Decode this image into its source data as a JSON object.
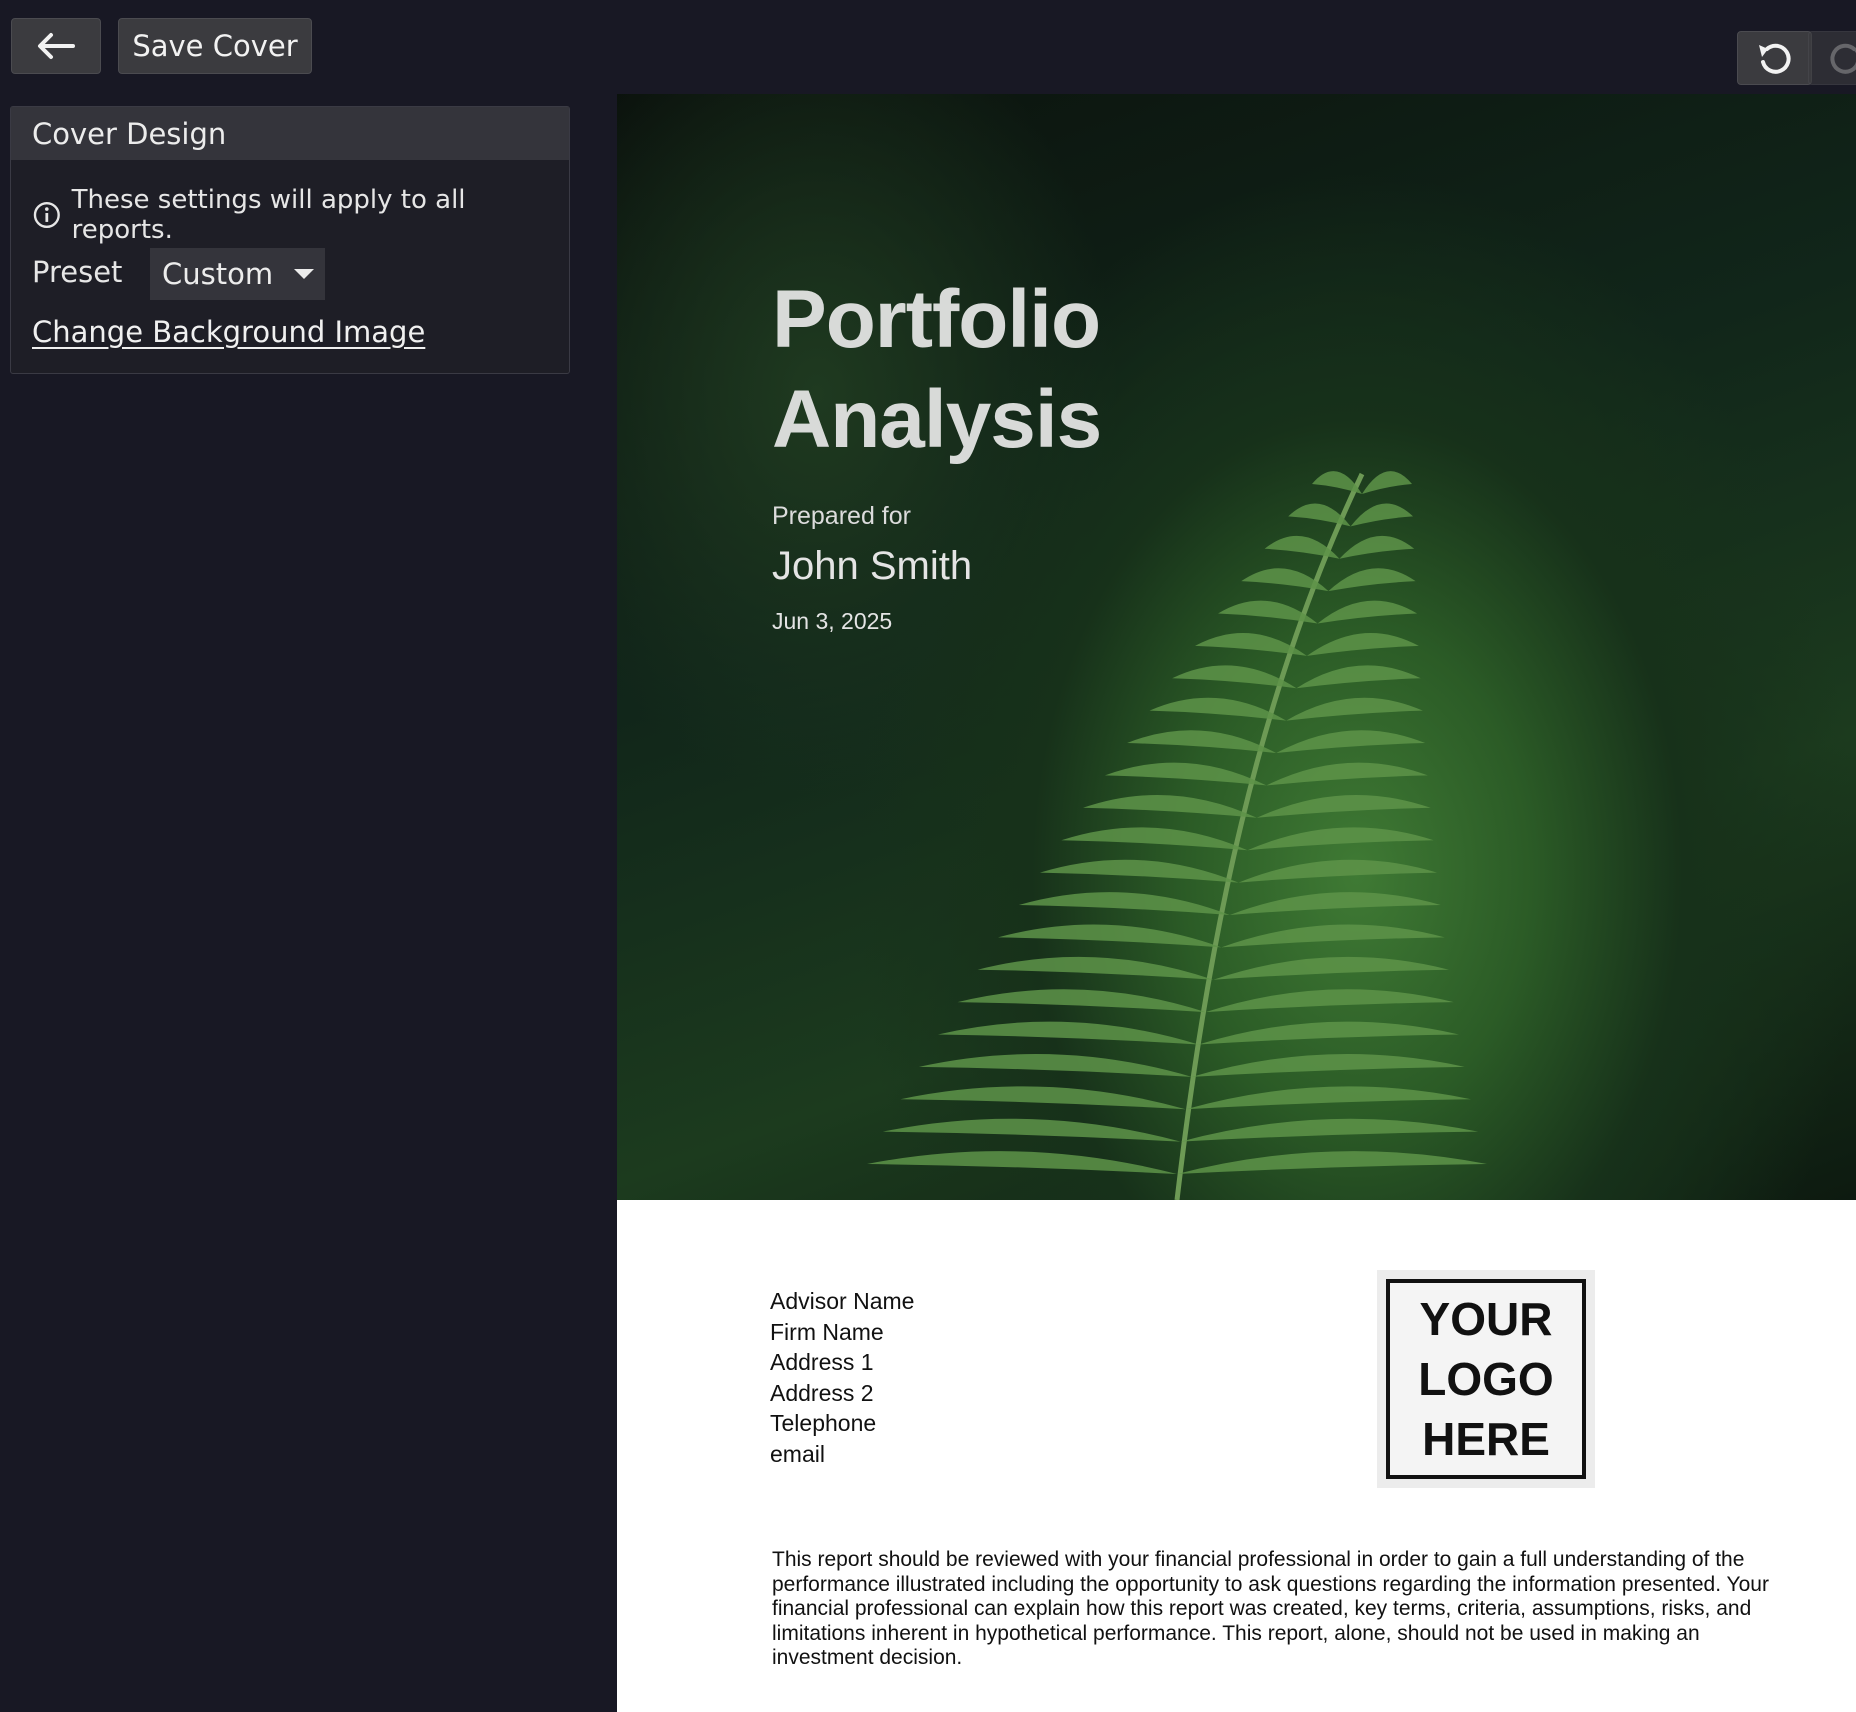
{
  "toolbar": {
    "back_icon": "arrow-left-icon",
    "save_label": "Save Cover",
    "undo_icon": "undo-icon",
    "redo_icon": "redo-icon"
  },
  "panel": {
    "title": "Cover Design",
    "info_icon": "info-icon",
    "info_text": "These settings will apply to all reports.",
    "preset_label": "Preset",
    "preset_value": "Custom",
    "change_background_label": "Change Background Image"
  },
  "cover": {
    "title_line1": "Portfolio",
    "title_line2": "Analysis",
    "prepared_for": "Prepared for",
    "client_name": "John Smith",
    "date": "Jun 3, 2025",
    "advisor": {
      "name": "Advisor Name",
      "firm": "Firm Name",
      "address1": "Address 1",
      "address2": "Address 2",
      "telephone": "Telephone",
      "email": "email"
    },
    "logo_lines": [
      "YOUR",
      "LOGO",
      "HERE"
    ],
    "disclaimer": "This report should be reviewed with your financial professional in order to gain a full understanding of the performance illustrated including the opportunity to ask questions regarding the information presented. Your financial professional can explain how this report was created, key terms, criteria, assumptions, risks, and limitations inherent in hypothetical performance. This report, alone, should not be used in making an investment decision."
  },
  "colors": {
    "background": "#181824",
    "button": "#3b3b3f",
    "panel_header": "#34343b"
  }
}
